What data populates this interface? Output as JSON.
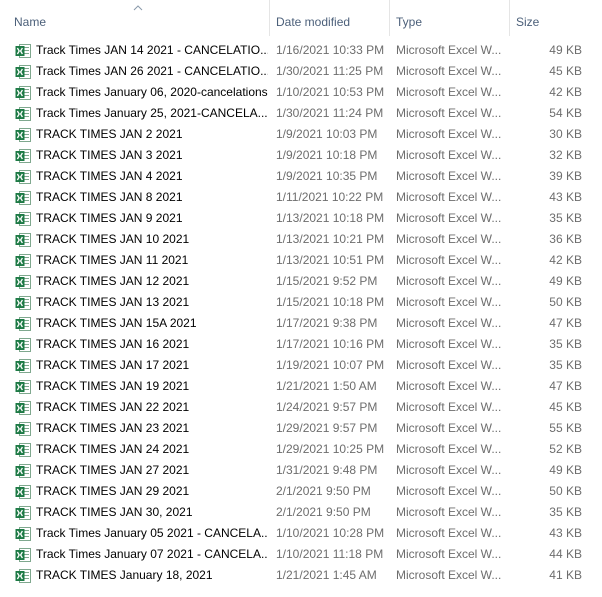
{
  "columns": {
    "name": "Name",
    "date": "Date modified",
    "type": "Type",
    "size": "Size"
  },
  "colors": {
    "header_text": "#4c607a",
    "excel_green": "#1d7a45",
    "secondary_text": "#6d6d6d"
  },
  "icons": {
    "file": "excel-file-icon",
    "sort": "sort-ascending-icon"
  },
  "files": [
    {
      "name": "Track Times  JAN 14 2021 - CANCELATIO...",
      "date": "1/16/2021 10:33 PM",
      "type": "Microsoft Excel W...",
      "size": "49 KB"
    },
    {
      "name": "Track Times  JAN 26 2021 - CANCELATIO...",
      "date": "1/30/2021 11:25 PM",
      "type": "Microsoft Excel W...",
      "size": "45 KB"
    },
    {
      "name": "Track Times  January 06, 2020-cancelations",
      "date": "1/10/2021 10:53 PM",
      "type": "Microsoft Excel W...",
      "size": "42 KB"
    },
    {
      "name": "Track Times  January 25, 2021-CANCELA...",
      "date": "1/30/2021 11:24 PM",
      "type": "Microsoft Excel W...",
      "size": "54 KB"
    },
    {
      "name": "TRACK TIMES JAN 2 2021",
      "date": "1/9/2021 10:03 PM",
      "type": "Microsoft Excel W...",
      "size": "30 KB"
    },
    {
      "name": "TRACK TIMES JAN 3 2021",
      "date": "1/9/2021 10:18 PM",
      "type": "Microsoft Excel W...",
      "size": "32 KB"
    },
    {
      "name": "TRACK TIMES JAN 4 2021",
      "date": "1/9/2021 10:35 PM",
      "type": "Microsoft Excel W...",
      "size": "39 KB"
    },
    {
      "name": "TRACK TIMES JAN 8 2021",
      "date": "1/11/2021 10:22 PM",
      "type": "Microsoft Excel W...",
      "size": "43 KB"
    },
    {
      "name": "TRACK TIMES JAN 9 2021",
      "date": "1/13/2021 10:18 PM",
      "type": "Microsoft Excel W...",
      "size": "35 KB"
    },
    {
      "name": "TRACK TIMES JAN 10 2021",
      "date": "1/13/2021 10:21 PM",
      "type": "Microsoft Excel W...",
      "size": "36 KB"
    },
    {
      "name": "TRACK TIMES JAN 11 2021",
      "date": "1/13/2021 10:51 PM",
      "type": "Microsoft Excel W...",
      "size": "42 KB"
    },
    {
      "name": "TRACK TIMES JAN 12 2021",
      "date": "1/15/2021 9:52 PM",
      "type": "Microsoft Excel W...",
      "size": "49 KB"
    },
    {
      "name": "TRACK TIMES JAN 13 2021",
      "date": "1/15/2021 10:18 PM",
      "type": "Microsoft Excel W...",
      "size": "50 KB"
    },
    {
      "name": "TRACK TIMES JAN 15A 2021",
      "date": "1/17/2021 9:38 PM",
      "type": "Microsoft Excel W...",
      "size": "47 KB"
    },
    {
      "name": "TRACK TIMES JAN 16 2021",
      "date": "1/17/2021 10:16 PM",
      "type": "Microsoft Excel W...",
      "size": "35 KB"
    },
    {
      "name": "TRACK TIMES JAN 17 2021",
      "date": "1/19/2021 10:07 PM",
      "type": "Microsoft Excel W...",
      "size": "35 KB"
    },
    {
      "name": "TRACK TIMES JAN 19 2021",
      "date": "1/21/2021 1:50 AM",
      "type": "Microsoft Excel W...",
      "size": "47 KB"
    },
    {
      "name": "TRACK TIMES JAN 22 2021",
      "date": "1/24/2021 9:57 PM",
      "type": "Microsoft Excel W...",
      "size": "45 KB"
    },
    {
      "name": "TRACK TIMES JAN 23 2021",
      "date": "1/29/2021 9:57 PM",
      "type": "Microsoft Excel W...",
      "size": "55 KB"
    },
    {
      "name": "TRACK TIMES JAN 24 2021",
      "date": "1/29/2021 10:25 PM",
      "type": "Microsoft Excel W...",
      "size": "52 KB"
    },
    {
      "name": "TRACK TIMES JAN 27 2021",
      "date": "1/31/2021 9:48 PM",
      "type": "Microsoft Excel W...",
      "size": "49 KB"
    },
    {
      "name": "TRACK TIMES JAN 29 2021",
      "date": "2/1/2021 9:50 PM",
      "type": "Microsoft Excel W...",
      "size": "50 KB"
    },
    {
      "name": "TRACK TIMES JAN 30, 2021",
      "date": "2/1/2021 9:50 PM",
      "type": "Microsoft Excel W...",
      "size": "35 KB"
    },
    {
      "name": "Track Times January 05 2021 - CANCELA...",
      "date": "1/10/2021 10:28 PM",
      "type": "Microsoft Excel W...",
      "size": "43 KB"
    },
    {
      "name": "Track Times January 07 2021 - CANCELA...",
      "date": "1/10/2021 11:18 PM",
      "type": "Microsoft Excel W...",
      "size": "44 KB"
    },
    {
      "name": "TRACK TIMES January 18, 2021",
      "date": "1/21/2021 1:45 AM",
      "type": "Microsoft Excel W...",
      "size": "41 KB"
    }
  ]
}
